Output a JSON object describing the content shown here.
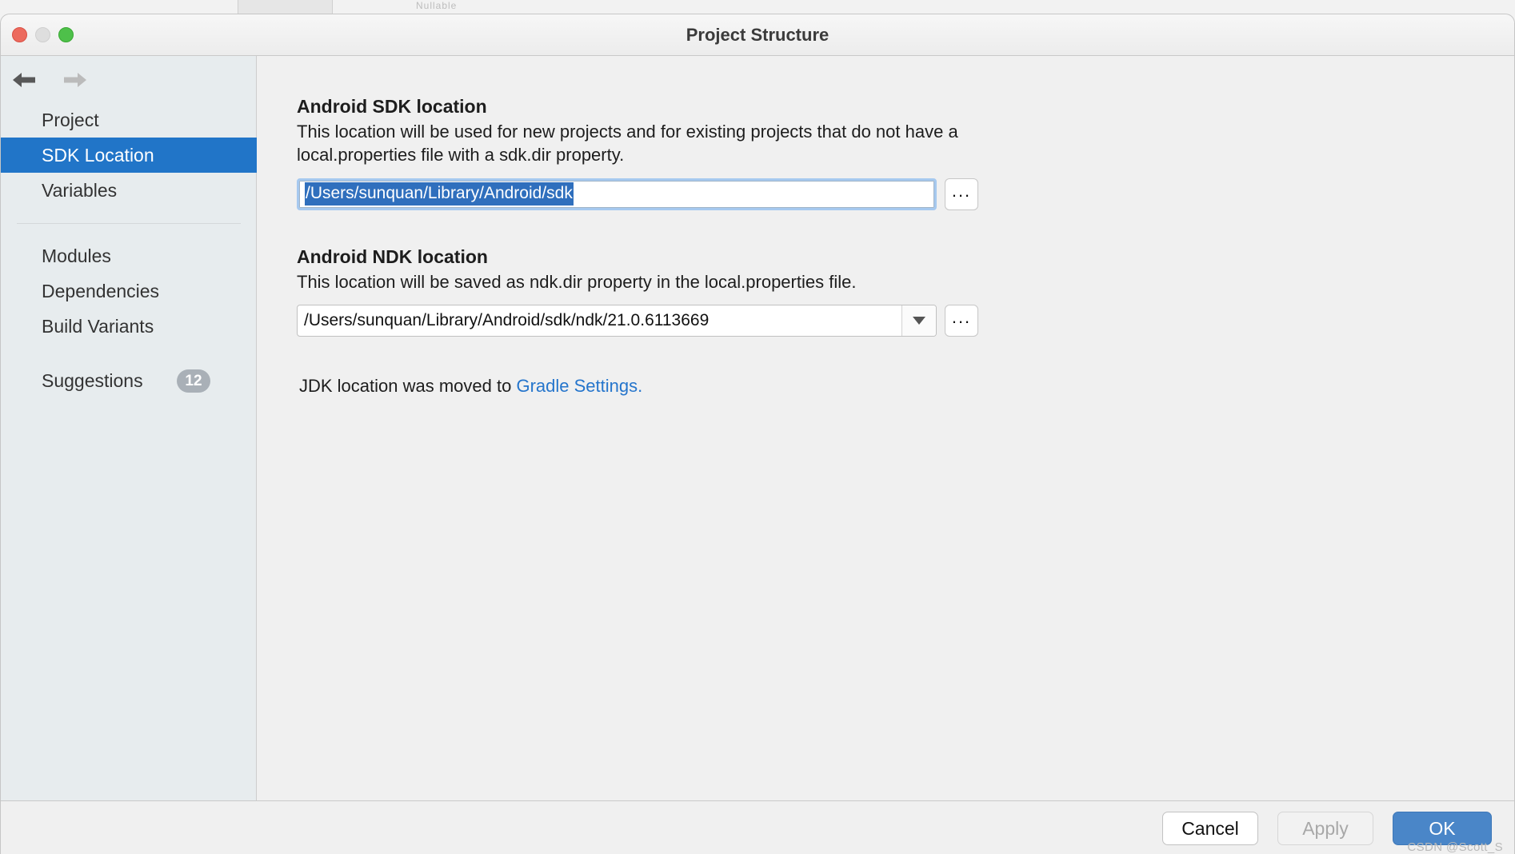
{
  "backdrop": {
    "ghost_text": "Nullable"
  },
  "titlebar": {
    "title": "Project Structure",
    "traffic_lights": {
      "close": "close-button",
      "minimize": "minimize-button",
      "zoom": "zoom-button"
    }
  },
  "sidebar": {
    "nav_back": "back-arrow",
    "nav_forward": "forward-arrow",
    "items": [
      {
        "label": "Project",
        "selected": false
      },
      {
        "label": "SDK Location",
        "selected": true
      },
      {
        "label": "Variables",
        "selected": false
      },
      {
        "label": "Modules",
        "selected": false
      },
      {
        "label": "Dependencies",
        "selected": false
      },
      {
        "label": "Build Variants",
        "selected": false
      },
      {
        "label": "Suggestions",
        "selected": false,
        "badge": "12"
      }
    ]
  },
  "main": {
    "sdk": {
      "title": "Android SDK location",
      "description": "This location will be used for new projects and for existing projects that do not have a local.properties file with a sdk.dir property.",
      "value": "/Users/sunquan/Library/Android/sdk",
      "browse_label": "...",
      "selected": true
    },
    "ndk": {
      "title": "Android NDK location",
      "description": "This location will be saved as ndk.dir property in the local.properties file.",
      "value": "/Users/sunquan/Library/Android/sdk/ndk/21.0.6113669",
      "browse_label": "...",
      "dropdown_icon": "chevron-down-icon"
    },
    "jdk_note": {
      "text": "JDK location was moved to ",
      "link_label": "Gradle Settings."
    }
  },
  "footer": {
    "cancel_label": "Cancel",
    "apply_label": "Apply",
    "ok_label": "OK",
    "watermark": "CSDN @Scott_S"
  },
  "colors": {
    "selection_blue": "#2175c8",
    "text_selection_blue": "#2f6fbd",
    "link_blue": "#2575cc",
    "ok_button_blue": "#4a86c8",
    "sidebar_bg": "#e7ecee",
    "main_bg": "#f0f0f0",
    "badge_gray": "#a9b0b7"
  }
}
